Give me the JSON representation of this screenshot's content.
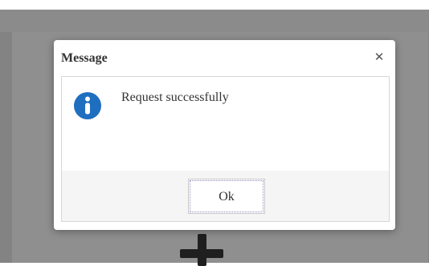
{
  "dialog": {
    "title": "Message",
    "close_icon": "close-icon",
    "message_icon": "info-icon",
    "message": "Request successfully",
    "ok_label": "Ok"
  },
  "background": {
    "icon": "plus-icon"
  },
  "colors": {
    "info_icon": "#1f6fc0",
    "overlay": "#838383"
  }
}
